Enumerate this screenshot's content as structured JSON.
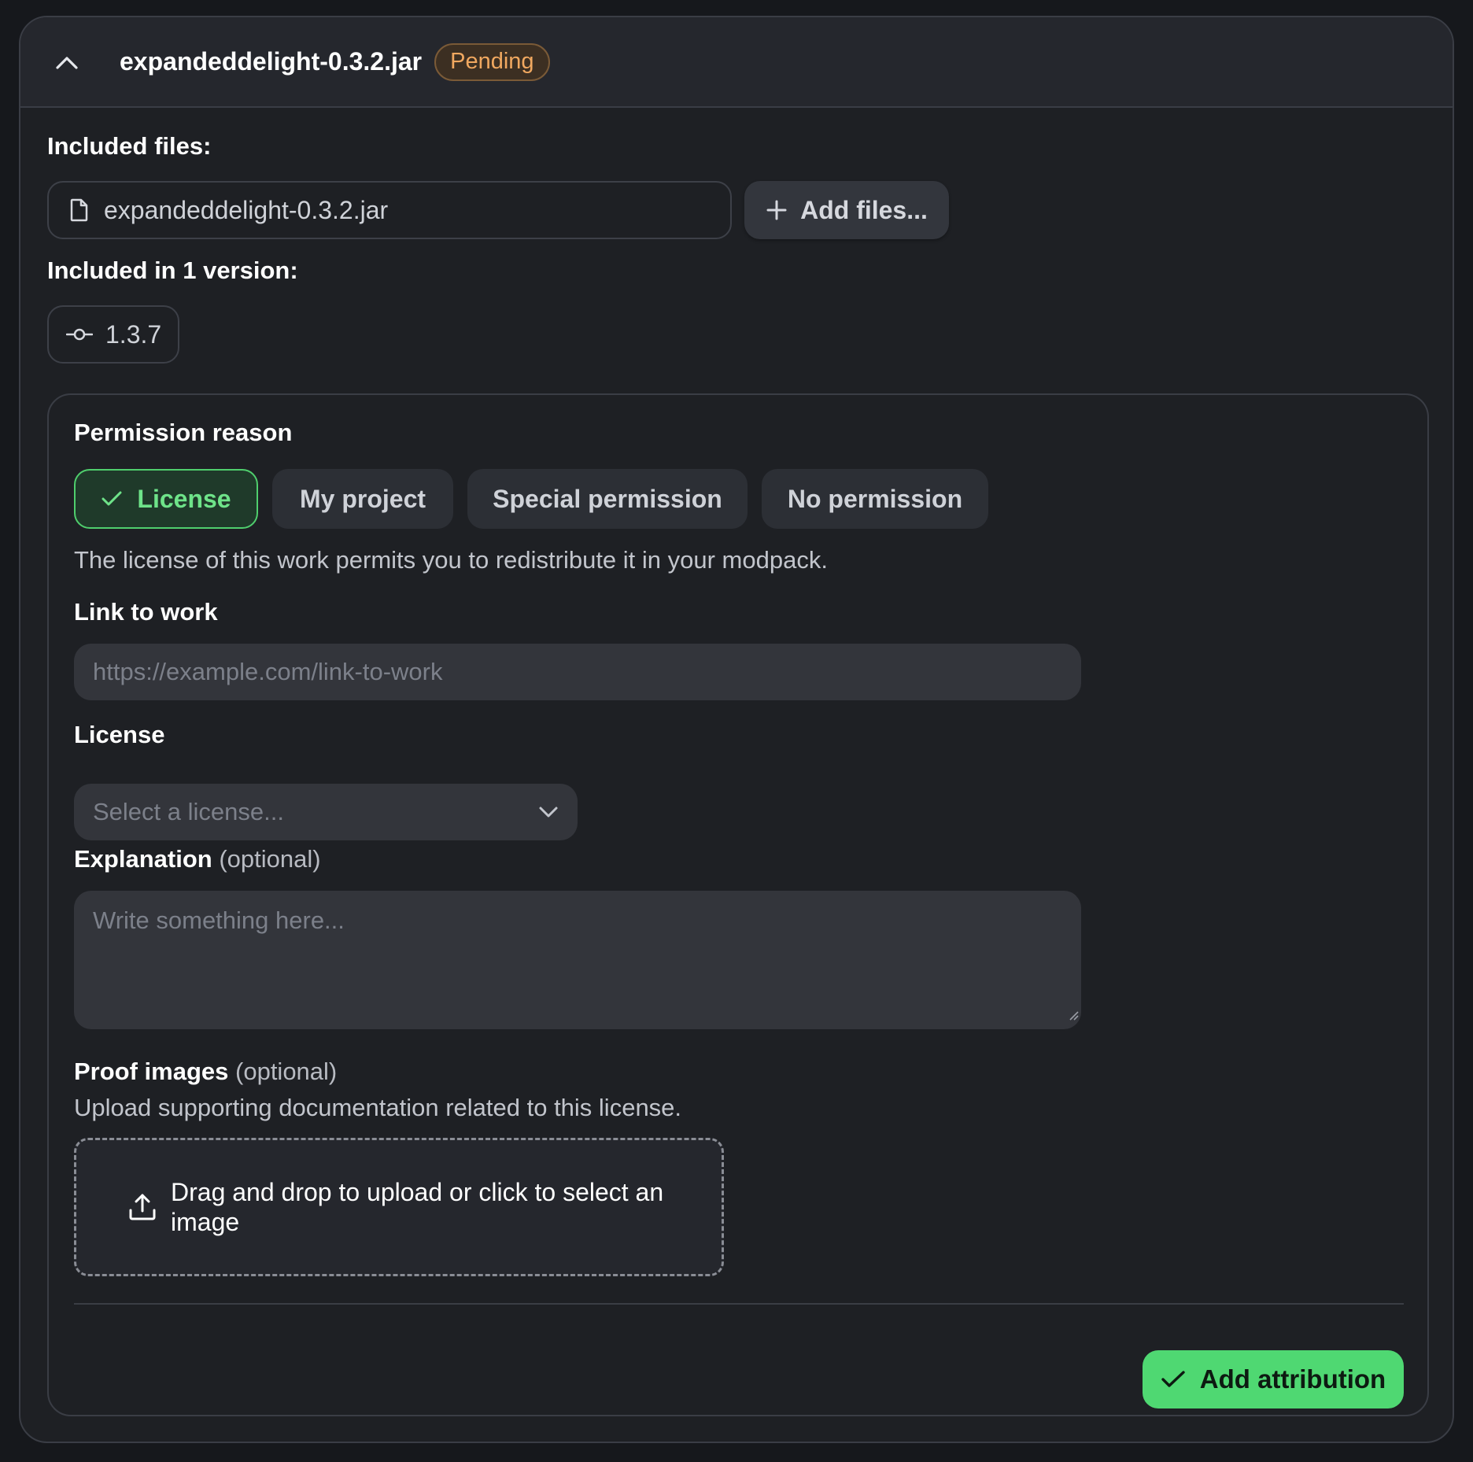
{
  "header": {
    "file_name": "expandeddelight-0.3.2.jar",
    "status": "Pending"
  },
  "included_files": {
    "label": "Included files:",
    "files": [
      "expandeddelight-0.3.2.jar"
    ],
    "add_button": "Add files..."
  },
  "included_versions": {
    "label": "Included in 1 version:",
    "versions": [
      "1.3.7"
    ]
  },
  "permission": {
    "label": "Permission reason",
    "options": [
      "License",
      "My project",
      "Special permission",
      "No permission"
    ],
    "selected": "License",
    "description": "The license of this work permits you to redistribute it in your modpack."
  },
  "link": {
    "label": "Link to work",
    "placeholder": "https://example.com/link-to-work"
  },
  "license": {
    "label": "License",
    "placeholder": "Select a license..."
  },
  "explanation": {
    "label": "Explanation",
    "optional": "(optional)",
    "placeholder": "Write something here..."
  },
  "proof": {
    "label": "Proof images",
    "optional": "(optional)",
    "description": "Upload supporting documentation related to this license.",
    "dropzone_text": "Drag and drop to upload or click to select an image"
  },
  "submit": {
    "label": "Add attribution"
  },
  "colors": {
    "accent_green": "#4fd872",
    "pending_orange": "#f0a860",
    "background": "#1e2024"
  },
  "icons": {
    "collapse": "chevron-up-icon",
    "file": "file-icon",
    "add": "plus-icon",
    "version": "commit-icon",
    "check": "check-icon",
    "dropdown": "chevron-down-icon",
    "upload": "upload-icon"
  }
}
